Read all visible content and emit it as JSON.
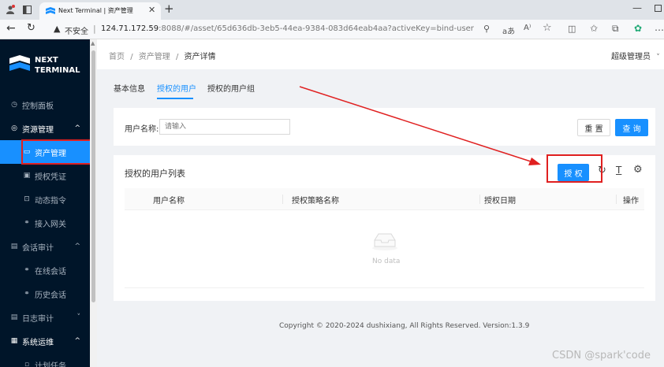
{
  "browser": {
    "tab_title": "Next Terminal | 资产管理",
    "new_tab": "+",
    "security": "不安全",
    "url_host": "124.71.172.59",
    "url_rest": ":8088/#/asset/65d636db-3eb5-44ea-9384-083d64eab4aa?activeKey=bind-user"
  },
  "brand": {
    "line1": "NEXT",
    "line2": "TERMINAL"
  },
  "sidebar": {
    "items": [
      {
        "label": "控制面板"
      },
      {
        "label": "资源管理"
      },
      {
        "label": "资产管理"
      },
      {
        "label": "授权凭证"
      },
      {
        "label": "动态指令"
      },
      {
        "label": "接入网关"
      },
      {
        "label": "会话审计"
      },
      {
        "label": "在线会话"
      },
      {
        "label": "历史会话"
      },
      {
        "label": "日志审计"
      },
      {
        "label": "系统运维"
      },
      {
        "label": "计划任务"
      }
    ]
  },
  "header": {
    "breadcrumb": [
      "首页",
      "资产管理",
      "资产详情"
    ],
    "separator": "/",
    "user": "超级管理员"
  },
  "tabs": [
    "基本信息",
    "授权的用户",
    "授权的用户组"
  ],
  "search": {
    "label": "用户名称:",
    "placeholder": "请输入",
    "reset": "重 置",
    "query": "查 询"
  },
  "list": {
    "title": "授权的用户列表",
    "authorize": "授 权",
    "columns": [
      "用户名称",
      "授权策略名称",
      "授权日期",
      "操作"
    ],
    "empty": "No data"
  },
  "footer": "Copyright © 2020-2024 dushixiang, All Rights Reserved. Version:1.3.9",
  "watermark": "CSDN @spark'code",
  "colors": {
    "primary": "#1890ff",
    "highlight_box": "#e02020",
    "sidebar_bg": "#001529",
    "active_item_bg": "#1890ff"
  }
}
